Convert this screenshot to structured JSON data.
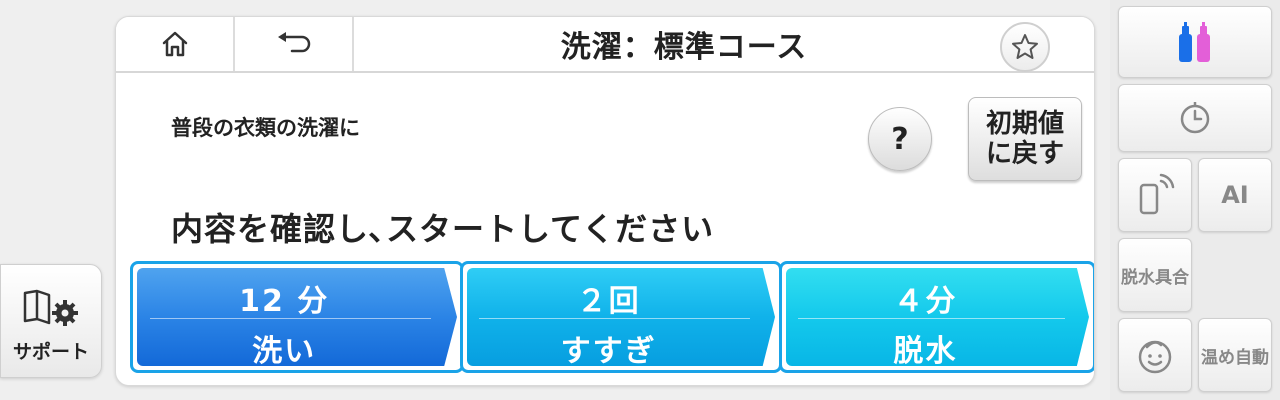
{
  "header": {
    "title": "洗濯：標準コース",
    "home_icon": "home-icon",
    "back_icon": "back-arrow-icon",
    "favorite_icon": "star-icon"
  },
  "content": {
    "description": "普段の衣類の洗濯に",
    "help_label": "?",
    "reset_label": "初期値に戻す",
    "prompt": "内容を確認し､スタートしてください"
  },
  "steps": [
    {
      "value": "12 分",
      "label": "洗い",
      "color": "#2b84e6"
    },
    {
      "value": "２回",
      "label": "すすぎ",
      "color": "#10b2ea"
    },
    {
      "value": "４分",
      "label": "脱水",
      "color": "#14c9ec"
    }
  ],
  "support": {
    "label": "サポート",
    "icon": "manual-gear-icon"
  },
  "sidebar": {
    "detergent_icon": "detergent-bottles-icon",
    "timer_icon": "timer-icon",
    "remote_icon": "smartphone-remote-icon",
    "ai_label": "AI",
    "spin_label": "脱水具合",
    "child_icon": "child-face-icon",
    "warm_label": "温め自動"
  },
  "colors": {
    "accent": "#1aa3e8",
    "panel_bg": "#ffffff",
    "page_bg": "#efefef"
  }
}
